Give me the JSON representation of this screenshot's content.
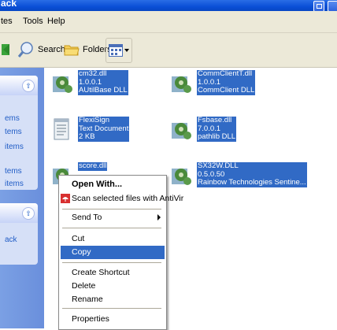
{
  "window": {
    "title": "ack"
  },
  "menubar": {
    "items": [
      "tes",
      "Tools",
      "Help"
    ]
  },
  "toolbar": {
    "search_label": "Search",
    "folders_label": "Folders"
  },
  "taskpane": {
    "box1_links": [
      "ems",
      "tems",
      "items",
      "tems",
      "items"
    ],
    "box2_links": [
      "ack"
    ]
  },
  "files": [
    {
      "name": "cm32.dll",
      "line2": "1.0.0.1",
      "line3": "AUtilBase DLL",
      "icon": "dll-gear-icon"
    },
    {
      "name": "CommClientT.dll",
      "line2": "1.0.0.1",
      "line3": "CommClient DLL",
      "icon": "dll-gear-icon"
    },
    {
      "name": "FlexiSign",
      "line2": "Text Document",
      "line3": "2 KB",
      "icon": "text-document-icon"
    },
    {
      "name": "Fsbase.dll",
      "line2": "7.0.0.1",
      "line3": "pathlib DLL",
      "icon": "dll-gear-icon"
    },
    {
      "name": "score.dll",
      "line2": "",
      "line3": "",
      "icon": "dll-gear-icon"
    },
    {
      "name": "SX32W.DLL",
      "line2": "0.5.0.50",
      "line3": "Rainbow Technologies Sentine...",
      "icon": "dll-gear-icon"
    }
  ],
  "context_menu": {
    "open_with": "Open With...",
    "scan": "Scan selected files with AntiVir",
    "send_to": "Send To",
    "cut": "Cut",
    "copy": "Copy",
    "create_shortcut": "Create Shortcut",
    "delete": "Delete",
    "rename": "Rename",
    "properties": "Properties"
  },
  "colors": {
    "selection": "#316ac5",
    "titlebar": "#0a4fd6",
    "taskpane": "#6a8fdc"
  }
}
